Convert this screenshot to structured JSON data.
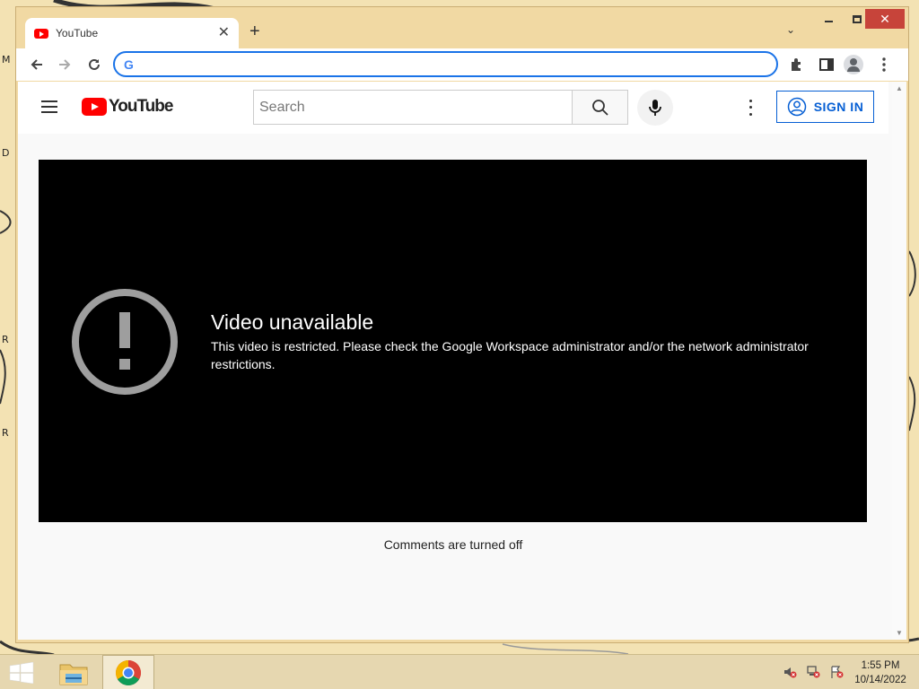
{
  "desktop": {
    "edge_letters": [
      "M",
      "D",
      "R",
      "R"
    ]
  },
  "browser": {
    "tab_title": "YouTube",
    "new_tab_symbol": "+",
    "tab_search_symbol": "⌄",
    "close_symbol": "✕",
    "omnibox": {
      "value": "",
      "placeholder": ""
    },
    "icons": [
      "back-arrow-icon",
      "forward-arrow-icon",
      "reload-icon",
      "extensions-puzzle-icon",
      "side-panel-icon",
      "profile-icon",
      "kebab-menu-icon"
    ]
  },
  "youtube": {
    "logo_text": "YouTube",
    "search_placeholder": "Search",
    "signin_label": "SIGN IN",
    "error_title": "Video unavailable",
    "error_message": "This video is restricted. Please check the Google Workspace administrator and/or the network administrator restrictions.",
    "comments_status": "Comments are turned off",
    "accent_color": "#ff0000",
    "link_color": "#065fd4"
  },
  "taskbar": {
    "apps": [
      "file-explorer",
      "google-chrome"
    ],
    "tray_icons": [
      "volume-muted-icon",
      "network-disconnected-icon",
      "action-center-flag-icon"
    ],
    "time": "1:55 PM",
    "date": "10/14/2022"
  }
}
